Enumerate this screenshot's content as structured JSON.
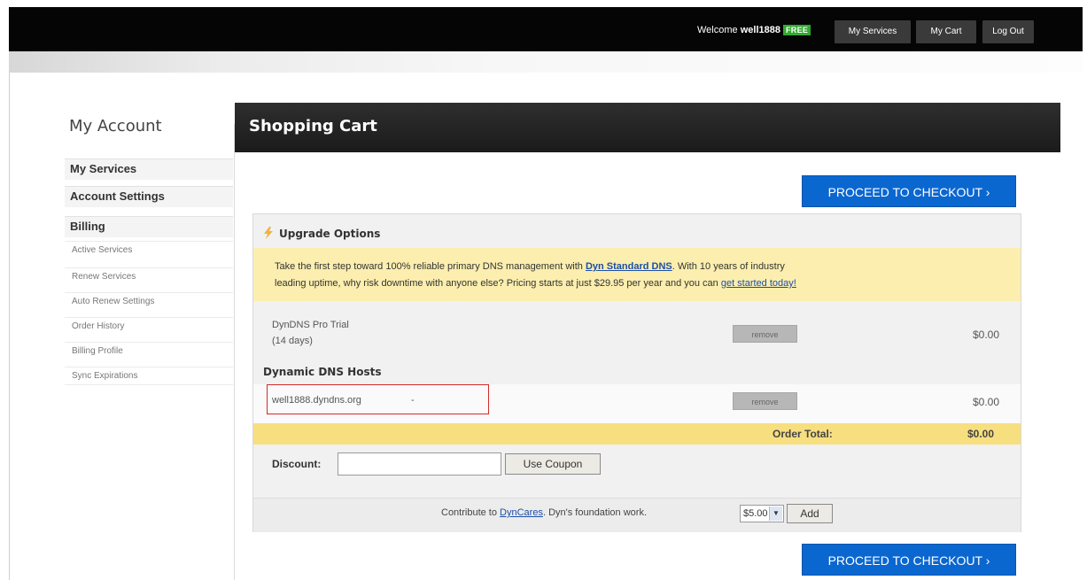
{
  "topbar": {
    "welcome_prefix": "Welcome",
    "username": "well1888",
    "badge": "FREE",
    "my_services": "My Services",
    "my_cart": "My Cart",
    "log_out": "Log Out"
  },
  "sidebar": {
    "title": "My Account",
    "major": [
      "My Services",
      "Account Settings",
      "Billing"
    ],
    "minor": [
      "Active Services",
      "Renew Services",
      "Auto Renew Settings",
      "Order History",
      "Billing Profile",
      "Sync Expirations"
    ]
  },
  "cart": {
    "title": "Shopping Cart",
    "checkout_label": "PROCEED TO CHECKOUT ›",
    "upgrade_title": "Upgrade Options",
    "promo": {
      "text1": "Take the first step toward 100% reliable primary DNS management with ",
      "link1": "Dyn Standard DNS",
      "text2": ". With 10 years of industry",
      "text3": "leading uptime, why risk downtime with anyone else? Pricing starts at just $29.95 per year and you can ",
      "link2": "get started today!"
    },
    "trial": {
      "name_line1": "DynDNS Pro Trial",
      "name_line2": "(14 days)",
      "remove_label": "remove",
      "price": "$0.00"
    },
    "hosts_title": "Dynamic DNS Hosts",
    "host": {
      "name": "well1888.dyndns.org",
      "dash": "-",
      "remove_label": "remove",
      "price": "$0.00"
    },
    "total_label": "Order Total:",
    "total_value": "$0.00",
    "discount_label": "Discount:",
    "discount_value": "",
    "coupon_button": "Use Coupon",
    "contrib_prefix": "Contribute to ",
    "contrib_link": "DynCares",
    "contrib_suffix": ". Dyn's foundation work.",
    "contrib_amount": "$5.00",
    "add_button": "Add"
  },
  "colors": {
    "accent_blue": "#0b67d0",
    "badge_green": "#34a832",
    "promo_yellow": "#fbeeae",
    "total_yellow": "#f7df80",
    "highlight_red": "#d42a2a"
  }
}
